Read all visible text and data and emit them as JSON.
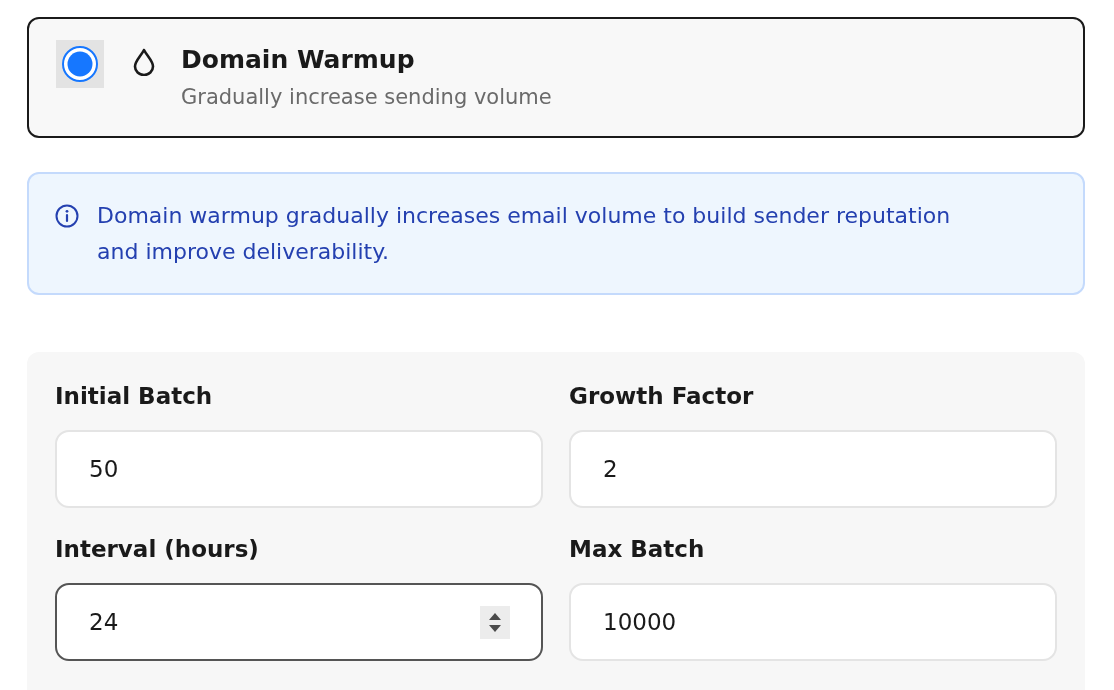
{
  "option": {
    "title": "Domain Warmup",
    "description": "Gradually increase sending volume",
    "selected": true
  },
  "info": {
    "text": "Domain warmup gradually increases email volume to build sender reputation and improve deliverability."
  },
  "fields": [
    {
      "label": "Initial Batch",
      "value": "50",
      "focused": false
    },
    {
      "label": "Growth Factor",
      "value": "2",
      "focused": false
    },
    {
      "label": "Interval (hours)",
      "value": "24",
      "focused": true
    },
    {
      "label": "Max Batch",
      "value": "10000",
      "focused": false
    }
  ]
}
